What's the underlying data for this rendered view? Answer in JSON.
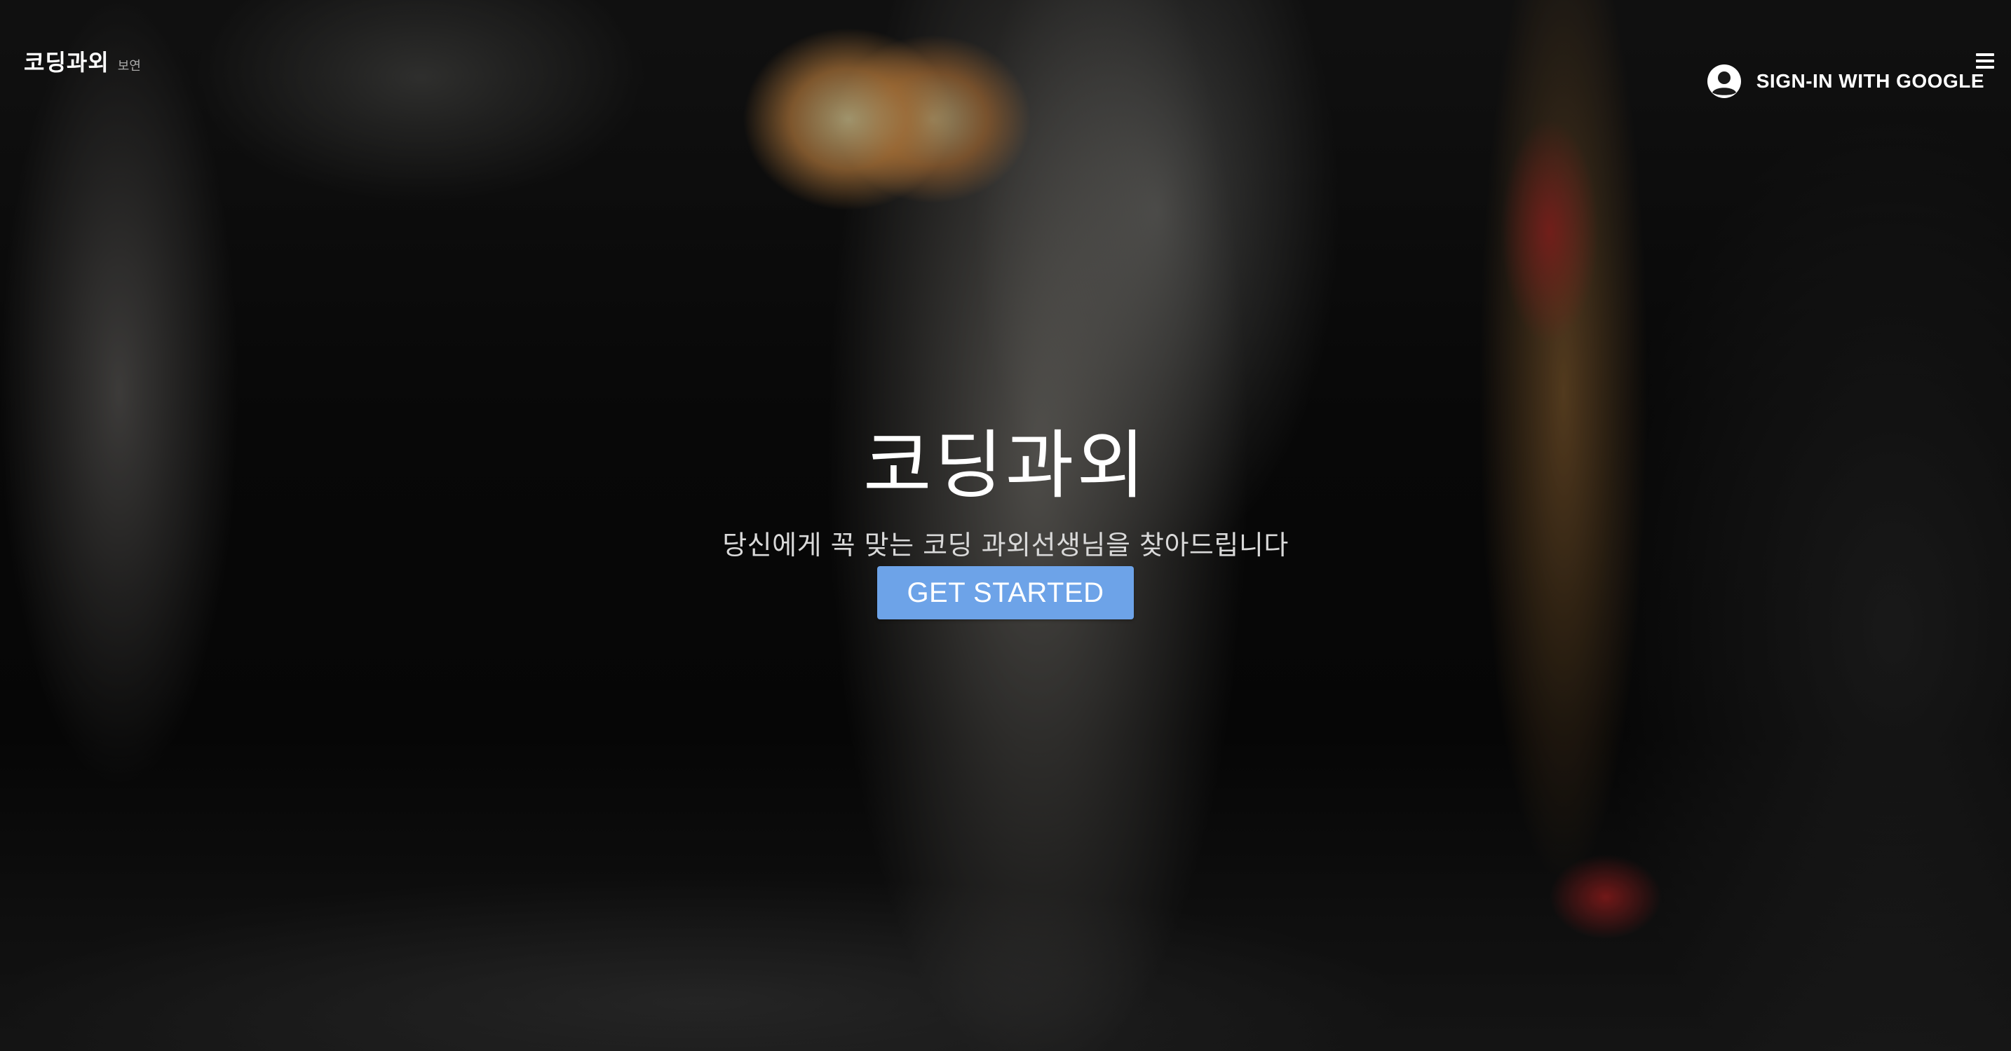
{
  "header": {
    "brand_name": "코딩과외",
    "brand_sub": "보연",
    "menu_icon": "hamburger-menu-icon",
    "signin_icon": "account-circle-icon",
    "signin_label": "SIGN-IN WITH GOOGLE"
  },
  "hero": {
    "title": "코딩과외",
    "subtitle": "당신에게 꼭 맞는 코딩 과외선생님을 찾아드립니다",
    "cta_label": "GET STARTED"
  },
  "colors": {
    "cta_background": "#6da3e8",
    "text": "#ffffff",
    "brand_sub": "#a9a9a9"
  }
}
